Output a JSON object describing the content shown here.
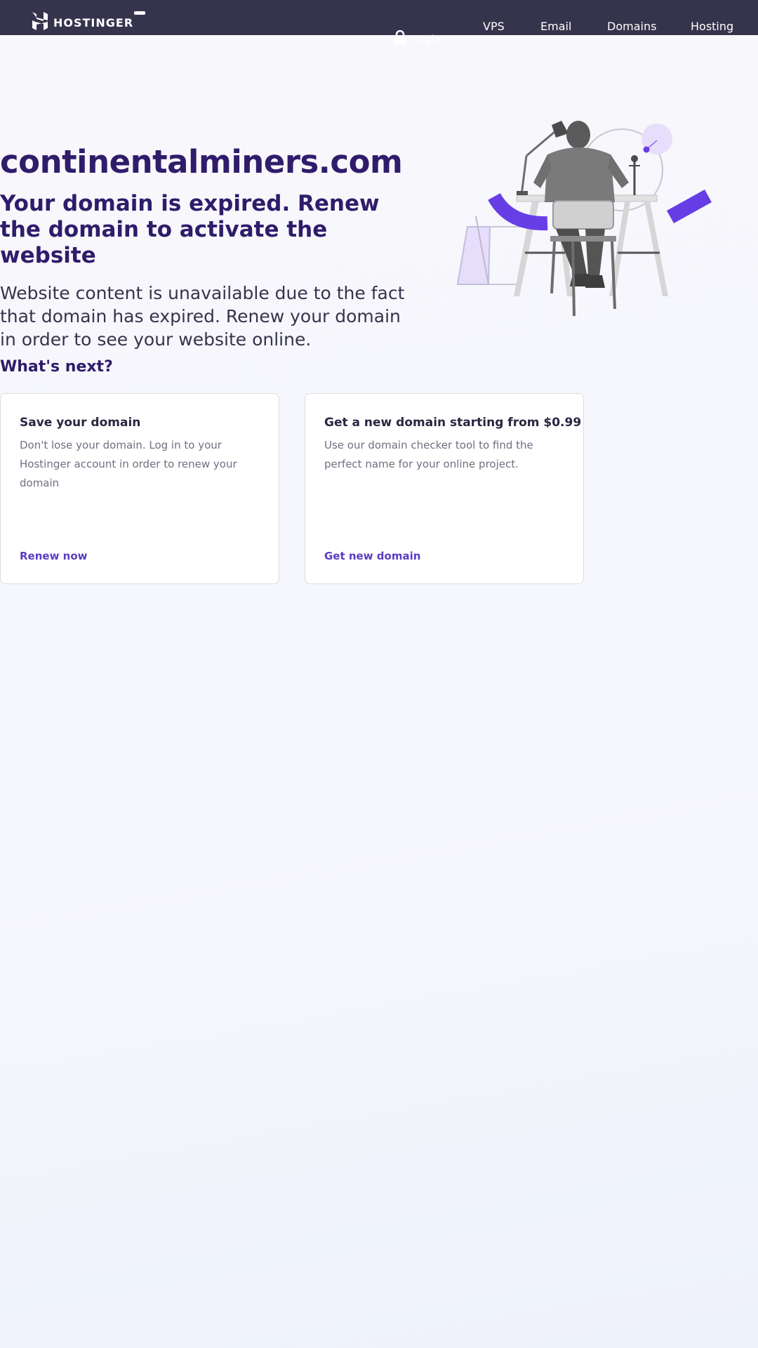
{
  "header": {
    "brand": "HOSTINGER",
    "nav": [
      "VPS",
      "Email",
      "Domains",
      "Hosting"
    ],
    "login_label": "Login"
  },
  "hero": {
    "domain": "continentalminers.com",
    "subtitle": "Your domain is expired. Renew the domain to activate the website",
    "description": "Website content is unavailable due to the fact that domain has expired. Renew your domain in order to see your website online."
  },
  "next": {
    "heading": "What's next?",
    "cards": [
      {
        "title": "Save your domain",
        "description": "Don't lose your domain. Log in to your Hostinger account in order to renew your domain",
        "link": "Renew now"
      },
      {
        "title": "Get a new domain starting from $0.99",
        "description": "Use our domain checker tool to find the perfect name for your online project.",
        "link": "Get new domain"
      }
    ]
  },
  "colors": {
    "header_bg": "#36344d",
    "brand_purple": "#673de6",
    "heading": "#2f1c6a"
  },
  "icons": {
    "logo": "hostinger-logo-icon",
    "login": "lock-icon"
  }
}
